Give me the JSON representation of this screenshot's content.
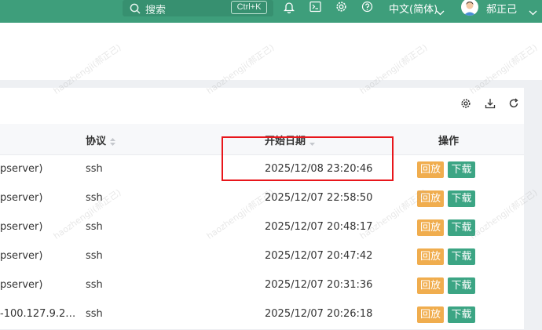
{
  "topbar": {
    "search_placeholder": "搜索",
    "search_shortcut": "Ctrl+K",
    "language": "中文(简体)",
    "username": "郝正己",
    "icons": [
      "bell-icon",
      "terminal-icon",
      "gear-icon",
      "help-icon"
    ]
  },
  "toolbar": {
    "icons": [
      "settings-icon",
      "download-icon",
      "refresh-icon"
    ]
  },
  "table": {
    "columns": {
      "protocol": "协议",
      "start_date": "开始日期",
      "actions": "操作"
    },
    "rows": [
      {
        "asset": "pserver)",
        "protocol": "ssh",
        "start": "2025/12/08 23:20:46"
      },
      {
        "asset": "pserver)",
        "protocol": "ssh",
        "start": "2025/12/07 22:58:50"
      },
      {
        "asset": "pserver)",
        "protocol": "ssh",
        "start": "2025/12/07 20:48:17"
      },
      {
        "asset": "pserver)",
        "protocol": "ssh",
        "start": "2025/12/07 20:47:42"
      },
      {
        "asset": "pserver)",
        "protocol": "ssh",
        "start": "2025/12/07 20:31:36"
      },
      {
        "asset": "-100.127.9.2…",
        "protocol": "ssh",
        "start": "2025/12/07 20:26:18"
      }
    ],
    "play_label": "回放",
    "download_label": "下载"
  },
  "watermark": "haozhengji(郝正己)",
  "colors": {
    "brand": "#3e9e7b",
    "play": "#f0ad4e",
    "download": "#3ca584",
    "highlight": "#e8161b"
  }
}
